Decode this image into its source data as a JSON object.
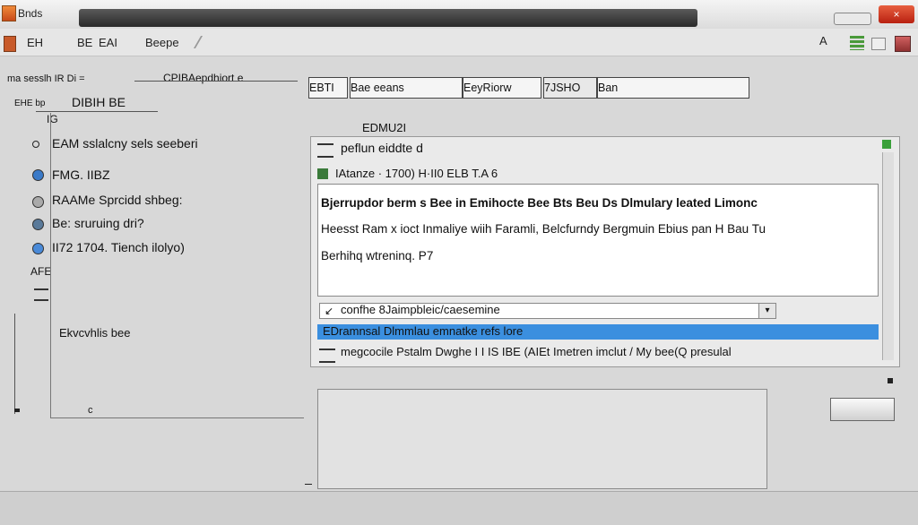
{
  "window": {
    "title": "Bnds",
    "close_label": "×"
  },
  "toolbar": {
    "items": [
      "EH",
      "BE",
      "EAI",
      "Beepe"
    ],
    "right_label": "A"
  },
  "left": {
    "header": "CPIBAepdhiort e",
    "header_prefix": "ma sesslh  IR  Di  =",
    "subheader_small": "EHE bp",
    "subheader_title": "DIBIH BE",
    "box_label": "IG",
    "items": [
      "EAM sslalcny sels seeberi",
      "FMG. IIBZ",
      "RAAMe Sprcidd shbeg:",
      "Be: sruruing dri?",
      "II72 1704. Tiench ilolyo)"
    ],
    "section_label": "AFE",
    "sub_item": "Ekvcvhlis bee",
    "box_note": "c"
  },
  "tabs": [
    {
      "label": "EBTI"
    },
    {
      "label": "Bae  eeans"
    },
    {
      "label": "EeyRiorw"
    },
    {
      "label": "7JSHO"
    },
    {
      "label": "Ban"
    }
  ],
  "main": {
    "heading": "EDMU2I",
    "header_row": "peflun eiddte d",
    "info_row": "IAtanze  ·  1700)  H·II0  ELB   T.A  6",
    "text_lines": [
      "Bjerrupdor  berm  s  Bee  in  Emihocte  Bee  Bts  Beu   Ds  Dlmulary  leated  Limonc",
      "Heesst  Ram  x  ioct  Inmaliye  wiih  Faramli,  Belcfurndy  Bergmuin  Ebius  pan  H  Bau  Tu",
      "Berhihq  wtreninq.  P7"
    ],
    "input_value": "confhe  8Jaimpbleic/caesemine",
    "selected_row": "EDramnsal  Dlmmlau  emnatke  refs  lore",
    "list_row": "megcocile  Pstalm  Dwghe  I  I  IS  IBE  (AIEt  Imetren  imclut    /  My  bee(Q  presulal"
  }
}
